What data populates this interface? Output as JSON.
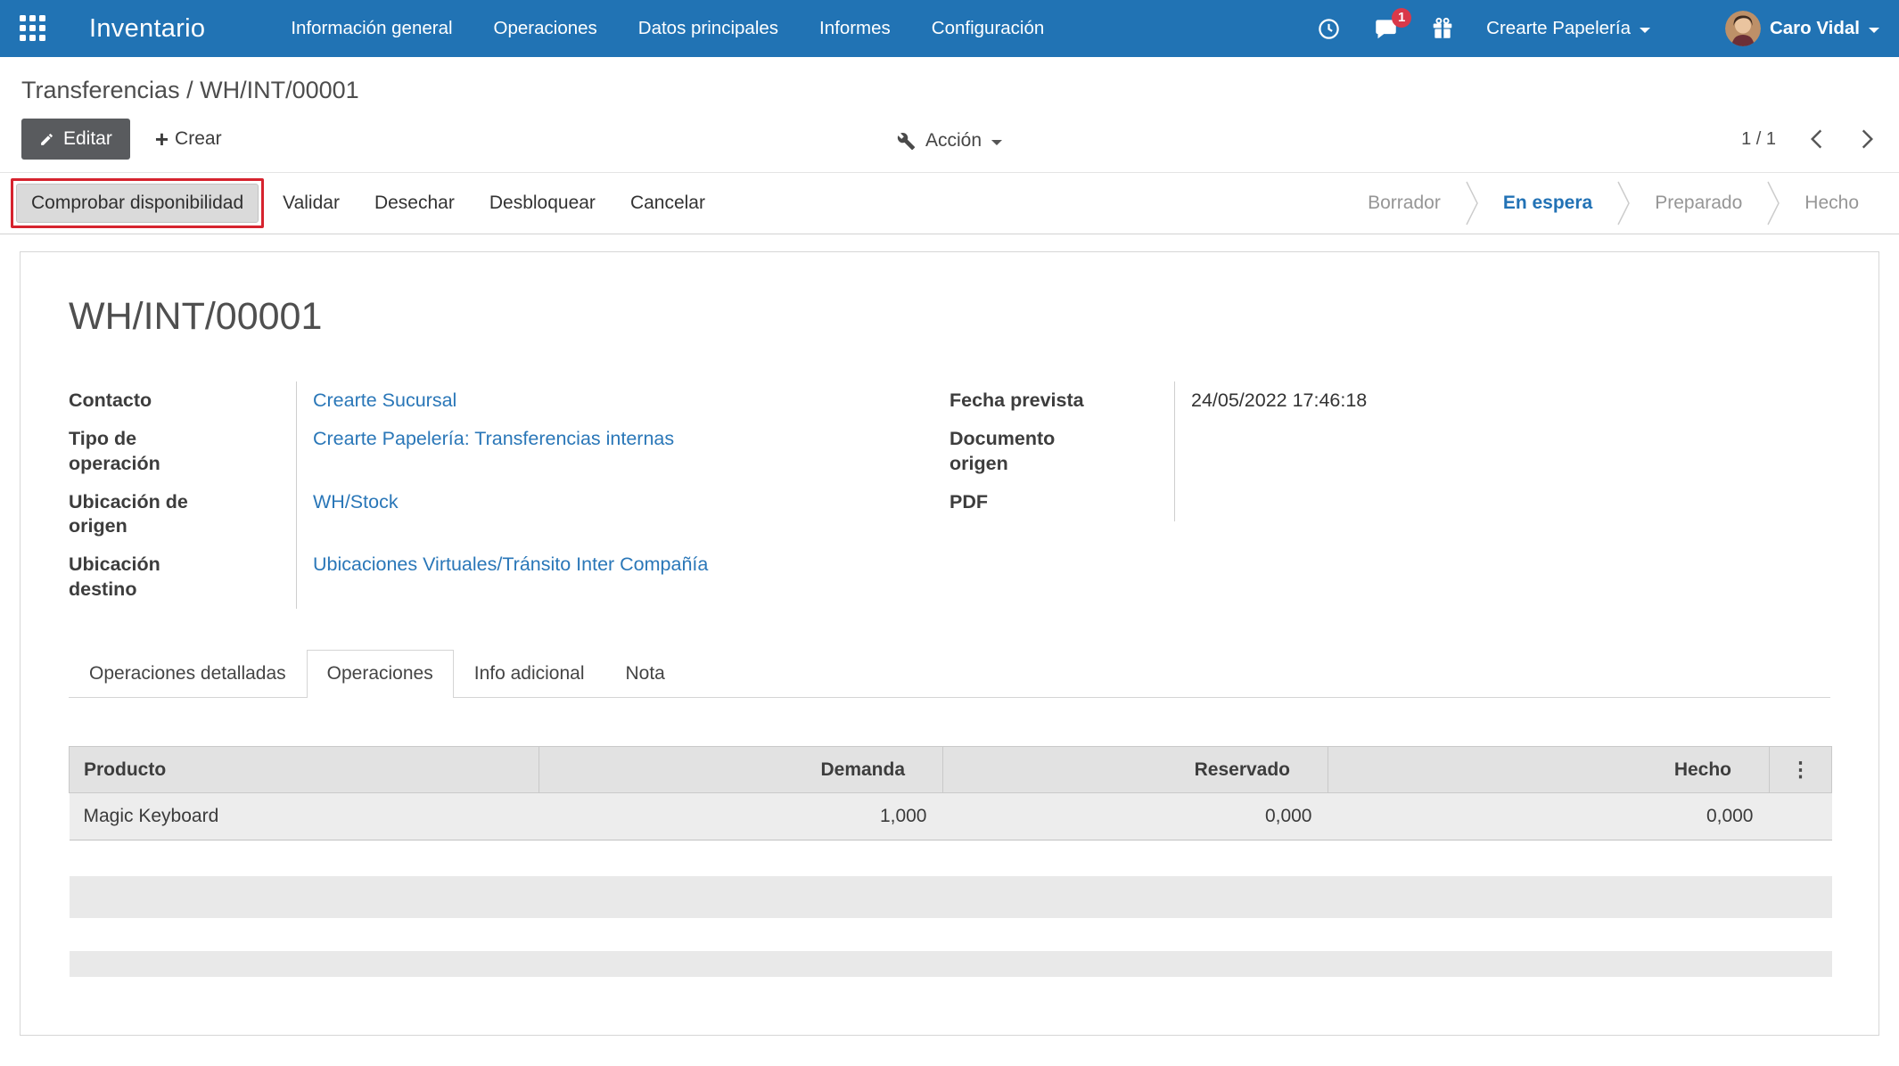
{
  "navbar": {
    "app_title": "Inventario",
    "menu_items": [
      "Información general",
      "Operaciones",
      "Datos principales",
      "Informes",
      "Configuración"
    ],
    "message_badge": "1",
    "company": "Crearte Papelería",
    "user": "Caro Vidal"
  },
  "breadcrumb": {
    "parent": "Transferencias",
    "separator": "/",
    "current": "WH/INT/00001"
  },
  "control_panel": {
    "edit_label": "Editar",
    "create_label": "Crear",
    "action_label": "Acción",
    "pager_value": "1 / 1"
  },
  "statusbar": {
    "check_availability": "Comprobar disponibilidad",
    "validate": "Validar",
    "scrap": "Desechar",
    "unlock": "Desbloquear",
    "cancel": "Cancelar",
    "stages": [
      {
        "label": "Borrador",
        "active": false
      },
      {
        "label": "En espera",
        "active": true
      },
      {
        "label": "Preparado",
        "active": false
      },
      {
        "label": "Hecho",
        "active": false
      }
    ]
  },
  "form": {
    "title": "WH/INT/00001",
    "fields_left": [
      {
        "label": "Contacto",
        "value": "Crearte Sucursal"
      },
      {
        "label": "Tipo de operación",
        "value": "Crearte Papelería: Transferencias internas"
      },
      {
        "label": "Ubicación de origen",
        "value": "WH/Stock"
      },
      {
        "label": "Ubicación destino",
        "value": "Ubicaciones Virtuales/Tránsito Inter Compañía"
      }
    ],
    "fields_right": [
      {
        "label": "Fecha prevista",
        "value": "24/05/2022 17:46:18"
      },
      {
        "label": "Documento origen",
        "value": ""
      },
      {
        "label": "PDF",
        "value": ""
      }
    ],
    "tabs": [
      {
        "label": "Operaciones detalladas",
        "active": false
      },
      {
        "label": "Operaciones",
        "active": true
      },
      {
        "label": "Info adicional",
        "active": false
      },
      {
        "label": "Nota",
        "active": false
      }
    ],
    "table": {
      "headers": [
        "Producto",
        "Demanda",
        "Reservado",
        "Hecho"
      ],
      "rows": [
        [
          "Magic Keyboard",
          "1,000",
          "0,000",
          "0,000"
        ]
      ]
    }
  },
  "icons": {
    "kebab": "⋮",
    "plus": "+"
  },
  "colors": {
    "navbar_blue": "#2173b4",
    "link_blue": "#2a77b8",
    "active_stage_blue": "#2272b5",
    "highlight_red": "#d6232e",
    "badge_red": "#d9394a"
  }
}
